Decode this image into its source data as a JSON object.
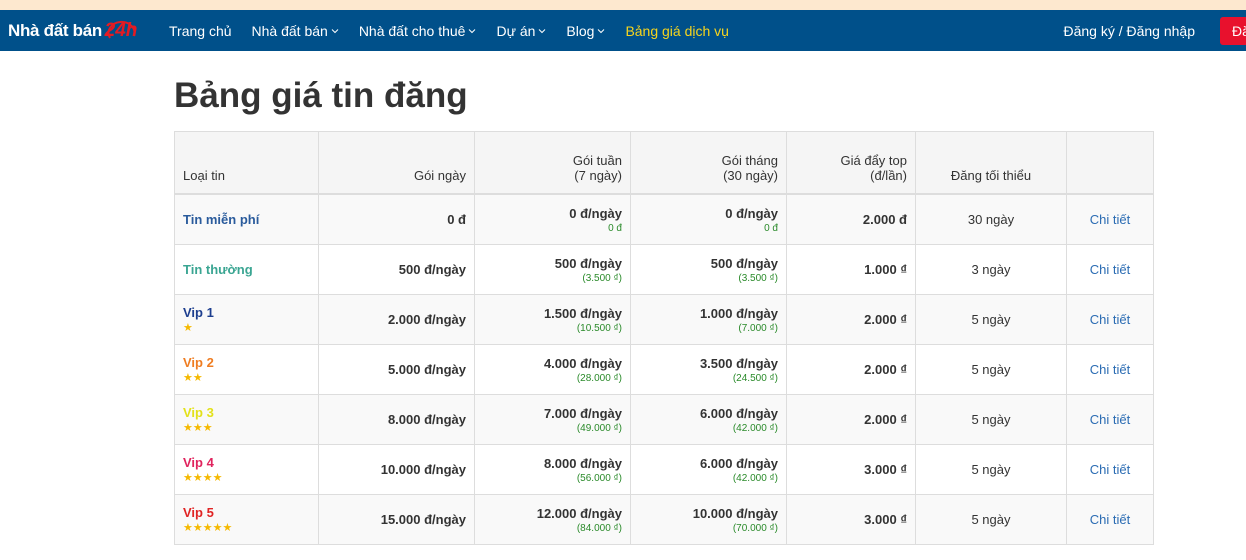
{
  "brand": {
    "name": "Nhà đất bán",
    "suffix": "24h"
  },
  "nav": {
    "items": [
      {
        "label": "Trang chủ",
        "dropdown": false
      },
      {
        "label": "Nhà đất bán",
        "dropdown": true
      },
      {
        "label": "Nhà đất cho thuê",
        "dropdown": true
      },
      {
        "label": "Dự án",
        "dropdown": true
      },
      {
        "label": "Blog",
        "dropdown": true
      },
      {
        "label": "Bảng giá dịch vụ",
        "dropdown": false,
        "active": true
      }
    ],
    "auth_label": "Đăng ký / Đăng nhập",
    "post_button_label": "Đăng tin"
  },
  "page": {
    "title": "Bảng giá tin đăng"
  },
  "table": {
    "headers": {
      "type": "Loại tin",
      "day": "Gói ngày",
      "week_line1": "Gói tuần",
      "week_line2": "(7 ngày)",
      "month_line1": "Gói tháng",
      "month_line2": "(30 ngày)",
      "push_line1": "Giá đẩy top",
      "push_line2": "(đ/lần)",
      "min_days": "Đăng tối thiểu",
      "action": ""
    },
    "rows": [
      {
        "name": "Tin miễn phí",
        "color": "#2a5b9c",
        "stars": "",
        "day": "0 đ",
        "week": "0 đ/ngày",
        "week_total": "0 đ",
        "month": "0 đ/ngày",
        "month_total": "0 đ",
        "push": "2.000 đ",
        "min_days": "30 ngày",
        "link": "Chi tiết"
      },
      {
        "name": "Tin thường",
        "color": "#3aa592",
        "stars": "",
        "day": "500 đ/ngày",
        "week": "500 đ/ngày",
        "week_total": "(3.500 ₫)",
        "month": "500 đ/ngày",
        "month_total": "(3.500 ₫)",
        "push": "1.000 ₫",
        "min_days": "3 ngày",
        "link": "Chi tiết"
      },
      {
        "name": "Vip 1",
        "color": "#1e3f8f",
        "stars": "★",
        "day": "2.000 đ/ngày",
        "week": "1.500 đ/ngày",
        "week_total": "(10.500 ₫)",
        "month": "1.000 đ/ngày",
        "month_total": "(7.000 ₫)",
        "push": "2.000 ₫",
        "min_days": "5 ngày",
        "link": "Chi tiết"
      },
      {
        "name": "Vip 2",
        "color": "#ef7d22",
        "stars": "★★",
        "day": "5.000 đ/ngày",
        "week": "4.000 đ/ngày",
        "week_total": "(28.000 ₫)",
        "month": "3.500 đ/ngày",
        "month_total": "(24.500 ₫)",
        "push": "2.000 ₫",
        "min_days": "5 ngày",
        "link": "Chi tiết"
      },
      {
        "name": "Vip 3",
        "color": "#e3e11a",
        "stars": "★★★",
        "day": "8.000 đ/ngày",
        "week": "7.000 đ/ngày",
        "week_total": "(49.000 ₫)",
        "month": "6.000 đ/ngày",
        "month_total": "(42.000 ₫)",
        "push": "2.000 ₫",
        "min_days": "5 ngày",
        "link": "Chi tiết"
      },
      {
        "name": "Vip 4",
        "color": "#e0245e",
        "stars": "★★★★",
        "day": "10.000 đ/ngày",
        "week": "8.000 đ/ngày",
        "week_total": "(56.000 ₫)",
        "month": "6.000 đ/ngày",
        "month_total": "(42.000 ₫)",
        "push": "3.000 ₫",
        "min_days": "5 ngày",
        "link": "Chi tiết"
      },
      {
        "name": "Vip 5",
        "color": "#e02424",
        "stars": "★★★★★",
        "day": "15.000 đ/ngày",
        "week": "12.000 đ/ngày",
        "week_total": "(84.000 ₫)",
        "month": "10.000 đ/ngày",
        "month_total": "(70.000 ₫)",
        "push": "3.000 ₫",
        "min_days": "5 ngày",
        "link": "Chi tiết"
      }
    ]
  },
  "colors": {
    "navbar": "#00508a",
    "accent": "#f7d51d",
    "post_button": "#e8112d",
    "link": "#2b6cb3",
    "sub_price": "#2a8a2a",
    "star": "#f5b900"
  }
}
